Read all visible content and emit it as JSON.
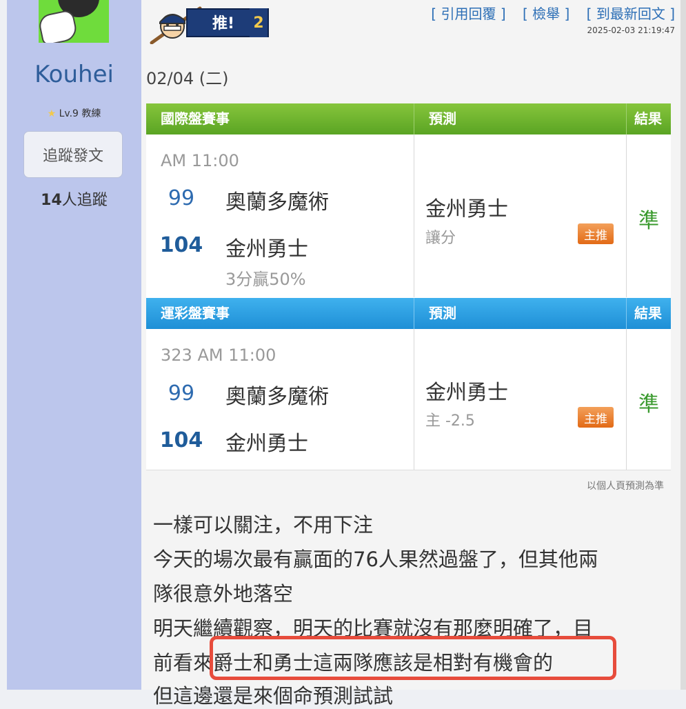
{
  "sidebar": {
    "username": "Kouhei",
    "level": "Lv.9 教練",
    "follow_button": "追蹤發文",
    "followers_count": "14",
    "followers_suffix": "人追蹤"
  },
  "post": {
    "push_label": "推!",
    "push_count": "2",
    "links": [
      "[ 引用回覆 ]",
      "[ 檢舉 ]",
      "[ 到最新回文 ]"
    ],
    "timestamp": "2025-02-03 21:19:47",
    "date": "02/04 (二)"
  },
  "international": {
    "header": "國際盤賽事",
    "pick_header": "預測",
    "result_header": "結果",
    "time": "AM 11:00",
    "away_score": "99",
    "away_team": "奧蘭多魔術",
    "home_score": "104",
    "home_team": "金州勇士",
    "note": "3分贏50%",
    "pick_team": "金州勇士",
    "pick_type": "讓分",
    "badge": "主推",
    "result": "準"
  },
  "sports_lottery": {
    "header": "運彩盤賽事",
    "pick_header": "預測",
    "result_header": "結果",
    "time": "323 AM 11:00",
    "away_score": "99",
    "away_team": "奧蘭多魔術",
    "home_score": "104",
    "home_team": "金州勇士",
    "pick_team": "金州勇士",
    "pick_type": "主 -2.5",
    "badge": "主推",
    "result": "準"
  },
  "disclaimer": "以個人頁預測為準",
  "body_lines": [
    "一樣可以關注，不用下注",
    "今天的場次最有贏面的76人果然過盤了，但其他兩",
    "隊很意外地落空",
    "明天繼續觀察，明天的比賽就沒有那麼明確了，目",
    "前看來爵士和勇士這兩隊應該是相對有機會的",
    "但這邊還是來個命預測試試"
  ],
  "colors": {
    "sidebar_bg": "#bcc6ec",
    "header_green": "#5aa423",
    "header_blue": "#1e8fd6",
    "link_blue": "#2d6fb6",
    "result_green": "#3a9a2e",
    "badge_orange": "#e26a16",
    "highlight_red": "#e74c3c"
  }
}
